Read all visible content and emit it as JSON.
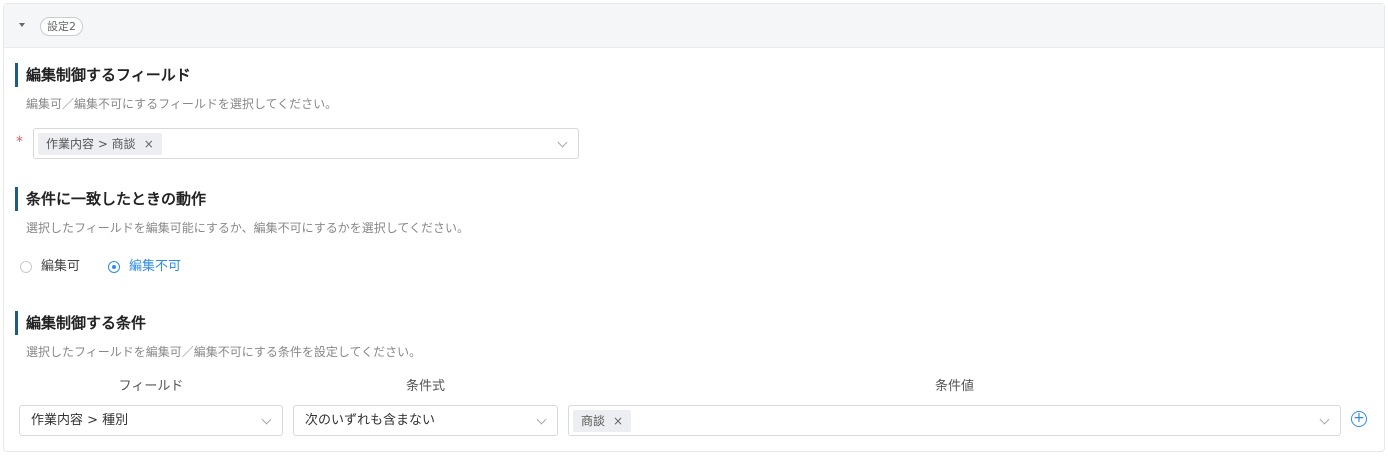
{
  "header": {
    "tag": "設定2"
  },
  "field_section": {
    "title": "編集制御するフィールド",
    "description": "編集可／編集不可にするフィールドを選択してください。",
    "required_mark": "*",
    "selected_chip": "作業内容 > 商談"
  },
  "action_section": {
    "title": "条件に一致したときの動作",
    "description": "選択したフィールドを編集可能にするか、編集不可にするかを選択してください。",
    "options": [
      {
        "label": "編集可",
        "selected": false
      },
      {
        "label": "編集不可",
        "selected": true
      }
    ]
  },
  "condition_section": {
    "title": "編集制御する条件",
    "description": "選択したフィールドを編集可／編集不可にする条件を設定してください。",
    "columns": {
      "field": "フィールド",
      "expression": "条件式",
      "value": "条件値"
    },
    "row": {
      "field": "作業内容 > 種別",
      "expression": "次のいずれも含まない",
      "value_chip": "商談"
    }
  },
  "icons": {
    "collapse": "caret-down-icon",
    "remove": "close-icon",
    "dropdown": "chevron-down-icon",
    "add": "plus-circle-icon"
  },
  "colors": {
    "accent": "#2d8ce6",
    "section_bar": "#1c5c86",
    "required": "#e25a5a"
  }
}
